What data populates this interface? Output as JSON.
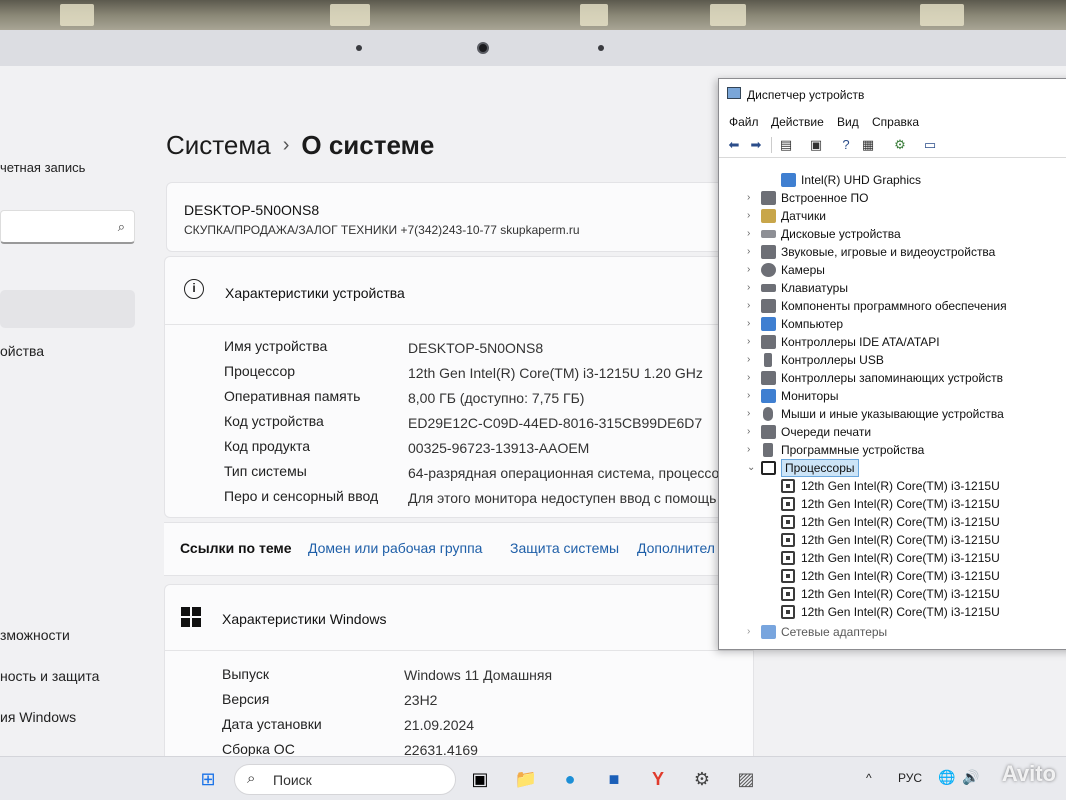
{
  "sidebar": {
    "account_fragment": "четная запись",
    "items": [
      "ойства",
      "зможности",
      "ность и защита",
      "ия Windows"
    ]
  },
  "breadcrumb": {
    "parent": "Система",
    "separator": "›",
    "current": "О системе"
  },
  "pc": {
    "name": "DESKTOP-5N0ONS8",
    "subtitle": "СКУПКА/ПРОДАЖА/ЗАЛОГ ТЕХНИКИ +7(342)243-10-77 skupkaperm.ru"
  },
  "device_specs": {
    "title": "Характеристики устройства",
    "rows": [
      {
        "label": "Имя устройства",
        "value": "DESKTOP-5N0ONS8"
      },
      {
        "label": "Процессор",
        "value": "12th Gen Intel(R) Core(TM) i3-1215U   1.20 GHz"
      },
      {
        "label": "Оперативная память",
        "value": "8,00 ГБ (доступно: 7,75 ГБ)"
      },
      {
        "label": "Код устройства",
        "value": "ED29E12C-C09D-44ED-8016-315CB99DE6D7"
      },
      {
        "label": "Код продукта",
        "value": "00325-96723-13913-AAOEM"
      },
      {
        "label": "Тип системы",
        "value": "64-разрядная операционная система, процессо"
      },
      {
        "label": "Перо и сенсорный ввод",
        "value": "Для этого монитора недоступен ввод с помощь"
      }
    ]
  },
  "related_links": {
    "label": "Ссылки по теме",
    "links": [
      "Домен или рабочая группа",
      "Защита системы",
      "Дополнител"
    ]
  },
  "windows_specs": {
    "title": "Характеристики Windows",
    "rows": [
      {
        "label": "Выпуск",
        "value": "Windows 11 Домашняя"
      },
      {
        "label": "Версия",
        "value": "23H2"
      },
      {
        "label": "Дата установки",
        "value": "21.09.2024"
      },
      {
        "label": "Сборка ОС",
        "value": "22631.4169"
      }
    ]
  },
  "taskbar": {
    "search_label": "Поиск",
    "language": "РУС",
    "watermark": "Avito"
  },
  "device_manager": {
    "title": "Диспетчер устройств",
    "menu": [
      "Файл",
      "Действие",
      "Вид",
      "Справка"
    ],
    "top_item": "Intel(R) UHD Graphics",
    "categories": [
      "Встроенное ПО",
      "Датчики",
      "Дисковые устройства",
      "Звуковые, игровые и видеоустройства",
      "Камеры",
      "Клавиатуры",
      "Компоненты программного обеспечения",
      "Компьютер",
      "Контроллеры IDE ATA/ATAPI",
      "Контроллеры USB",
      "Контроллеры запоминающих устройств",
      "Мониторы",
      "Мыши и иные указывающие устройства",
      "Очереди печати",
      "Программные устройства"
    ],
    "selected_category": "Процессоры",
    "processors": [
      "12th Gen Intel(R) Core(TM) i3-1215U",
      "12th Gen Intel(R) Core(TM) i3-1215U",
      "12th Gen Intel(R) Core(TM) i3-1215U",
      "12th Gen Intel(R) Core(TM) i3-1215U",
      "12th Gen Intel(R) Core(TM) i3-1215U",
      "12th Gen Intel(R) Core(TM) i3-1215U",
      "12th Gen Intel(R) Core(TM) i3-1215U",
      "12th Gen Intel(R) Core(TM) i3-1215U"
    ],
    "bottom_partial": "Сетевые адаптеры"
  }
}
